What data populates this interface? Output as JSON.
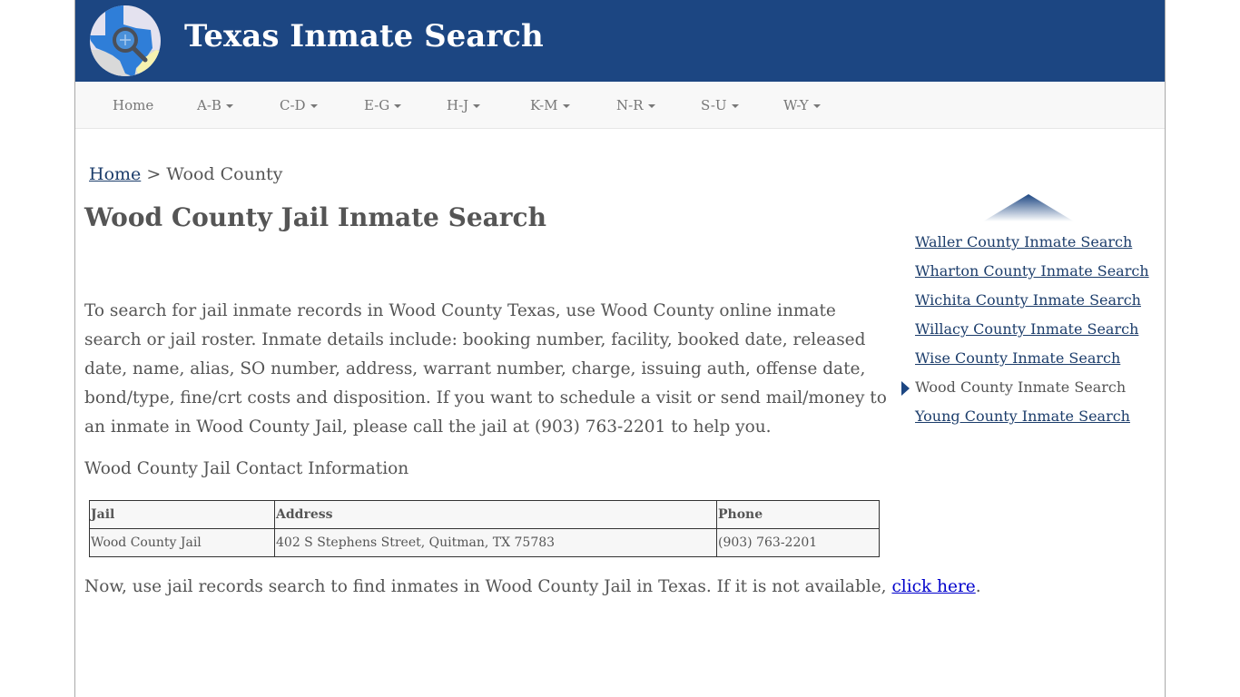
{
  "site": {
    "title": "Texas Inmate Search",
    "logo_icon": "texas-map-magnifier-icon",
    "brand_color": "#1c4682"
  },
  "nav": {
    "items": [
      {
        "label": "Home",
        "dropdown": false
      },
      {
        "label": "A-B",
        "dropdown": true
      },
      {
        "label": "C-D",
        "dropdown": true
      },
      {
        "label": "E-G",
        "dropdown": true
      },
      {
        "label": "H-J",
        "dropdown": true
      },
      {
        "label": "K-M",
        "dropdown": true
      },
      {
        "label": "N-R",
        "dropdown": true
      },
      {
        "label": "S-U",
        "dropdown": true
      },
      {
        "label": "W-Y",
        "dropdown": true
      }
    ]
  },
  "breadcrumb": {
    "home": "Home",
    "separator": " > ",
    "current": "Wood County"
  },
  "main": {
    "title": "Wood County Jail Inmate Search",
    "intro": "To search for jail inmate records in Wood County Texas, use Wood County online inmate search or jail roster. Inmate details include: booking number, facility, booked date, released date, name, alias, SO number, address, warrant number, charge, issuing auth, offense date, bond/type, fine/crt costs and disposition. If you want to schedule a visit or send mail/money to an inmate in Wood County Jail, please call the jail at (903) 763-2201 to help you.",
    "contact_heading": "Wood County Jail Contact Information",
    "table": {
      "headers": [
        "Jail",
        "Address",
        "Phone"
      ],
      "rows": [
        [
          "Wood County Jail",
          "402 S Stephens Street, Quitman, TX 75783",
          "(903) 763-2201"
        ]
      ]
    },
    "outro_text": "Now, use jail records search to find inmates in Wood County Jail in Texas. If it is not available, ",
    "outro_link": "click here",
    "outro_end": "."
  },
  "sidebar": {
    "arrow_icon": "scroll-up-arrow-icon",
    "items": [
      {
        "label": "Waller County Inmate Search",
        "current": false
      },
      {
        "label": "Wharton County Inmate Search",
        "current": false
      },
      {
        "label": "Wichita County Inmate Search",
        "current": false
      },
      {
        "label": "Willacy County Inmate Search",
        "current": false
      },
      {
        "label": "Wise County Inmate Search",
        "current": false
      },
      {
        "label": "Wood County Inmate Search",
        "current": true
      },
      {
        "label": "Young County Inmate Search",
        "current": false
      }
    ]
  }
}
